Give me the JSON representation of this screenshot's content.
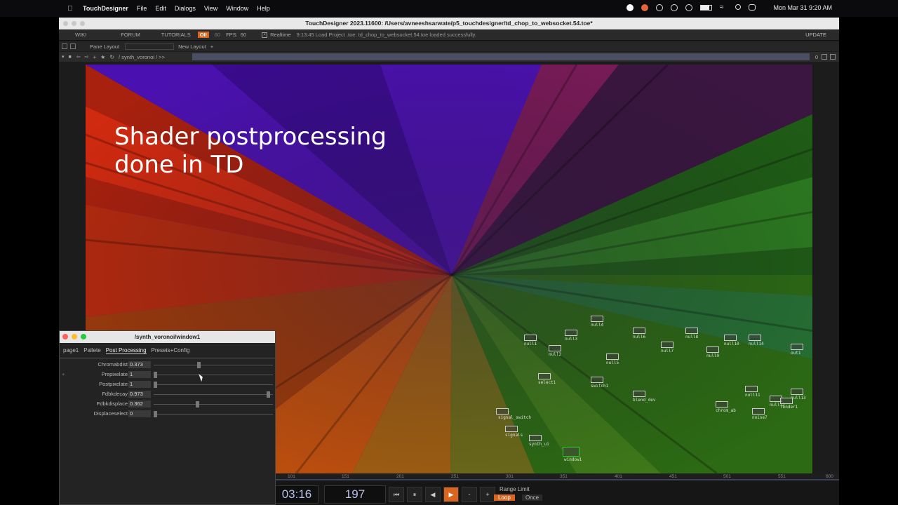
{
  "menubar": {
    "app_name": "TouchDesigner",
    "items": [
      "File",
      "Edit",
      "Dialogs",
      "View",
      "Window",
      "Help"
    ],
    "clock": "Mon Mar 31  9:20 AM"
  },
  "window": {
    "title": "TouchDesigner 2023.11600: /Users/avneeshsarwate/p5_touchdesigner/td_chop_to_websocket.54.toe*"
  },
  "topbar": {
    "wiki": "WIKI",
    "forum": "FORUM",
    "tutorials": "TUTORIALS",
    "oii": "OII",
    "sixty": "60",
    "fps_label": "FPS:",
    "fps_value": "60",
    "realtime": "Realtime",
    "status": "9:13:45 Load Project .toe: td_chop_to_websocket.54.toe loaded successfully.",
    "update": "UPDATE"
  },
  "panebar": {
    "pane_layout": "Pane Layout",
    "new_layout": "New Layout",
    "plus": "+"
  },
  "pathbar": {
    "path": "/ synth_voronoi /  >>",
    "right_count": "0"
  },
  "viewer": {
    "overlay_line1": "Shader postprocessing",
    "overlay_line2": "done in TD"
  },
  "nodes": [
    {
      "label": "window1"
    },
    {
      "label": "null1"
    },
    {
      "label": "null2"
    },
    {
      "label": "null3"
    },
    {
      "label": "null4"
    },
    {
      "label": "null5"
    },
    {
      "label": "null6"
    },
    {
      "label": "null7"
    },
    {
      "label": "null8"
    },
    {
      "label": "null9"
    },
    {
      "label": "null10"
    },
    {
      "label": "null11"
    },
    {
      "label": "null12"
    },
    {
      "label": "null13"
    },
    {
      "label": "null14"
    },
    {
      "label": "render1"
    },
    {
      "label": "out1"
    },
    {
      "label": "chrom_ab"
    },
    {
      "label": "signal_switch"
    },
    {
      "label": "signals"
    },
    {
      "label": "synth_ui"
    },
    {
      "label": "select1"
    },
    {
      "label": "switch1"
    },
    {
      "label": "noise7"
    },
    {
      "label": "blend_dev"
    }
  ],
  "timeline": {
    "ticks": [
      "101",
      "151",
      "201",
      "251",
      "301",
      "351",
      "401",
      "451",
      "501",
      "551",
      "600"
    ],
    "timecode": "03:16",
    "frame": "197",
    "range_limit": "Range Limit",
    "loop": "Loop",
    "once": "Once",
    "buttons": [
      "⏮",
      "⏸",
      "◀",
      "▶",
      "-",
      "+"
    ]
  },
  "param_window": {
    "title": "/synth_voronoi/window1",
    "tabs": [
      "page1",
      "Pallete",
      "Post Processing",
      "Presets+Config"
    ],
    "selected_tab": "Post Processing",
    "params": [
      {
        "name": "Chromabdist",
        "value": "0.373",
        "level": 0.373
      },
      {
        "name": "Prepixelate",
        "value": "1",
        "level": 0.0
      },
      {
        "name": "Postpixelate",
        "value": "1",
        "level": 0.0
      },
      {
        "name": "Fdbkdecay",
        "value": "0.973",
        "level": 0.973
      },
      {
        "name": "Fdbkdisplace",
        "value": "0.362",
        "level": 0.362
      },
      {
        "name": "Displaceselect",
        "value": "0",
        "level": 0.0
      }
    ]
  }
}
